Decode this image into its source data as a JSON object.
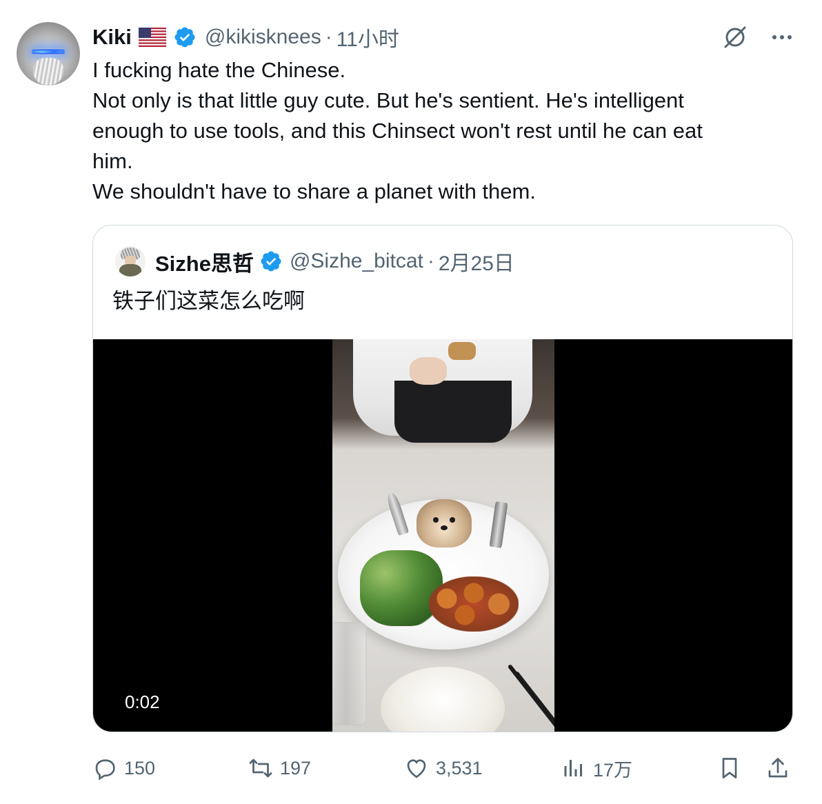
{
  "author": {
    "name": "Kiki",
    "handle": "@kikisknees",
    "separator": "·",
    "time": "11小时"
  },
  "tweet_lines": [
    "I fucking hate the Chinese.",
    "Not only is that little guy cute. But he's sentient. He's intelligent",
    "enough to use tools, and this Chinsect won't rest until he can eat",
    "him.",
    "We shouldn't have to share a planet with them."
  ],
  "quoted": {
    "name": "Sizhe思哲",
    "handle": "@Sizhe_bitcat",
    "separator": "·",
    "time": "2月25日",
    "text": "铁子们这菜怎么吃啊",
    "video_timestamp": "0:02"
  },
  "actions": {
    "replies": "150",
    "retweets": "197",
    "likes": "3,531",
    "views": "17万"
  },
  "icons": {
    "verified": "verified-badge-icon",
    "flag": "us-flag-icon",
    "grok": "grok-icon",
    "more": "more-icon",
    "reply": "reply-icon",
    "retweet": "retweet-icon",
    "like": "heart-icon",
    "views": "views-icon",
    "bookmark": "bookmark-icon",
    "share": "share-icon"
  },
  "colors": {
    "text": "#0f1419",
    "secondary": "#536471",
    "verified": "#1d9bf0",
    "border": "#cfd9de"
  }
}
